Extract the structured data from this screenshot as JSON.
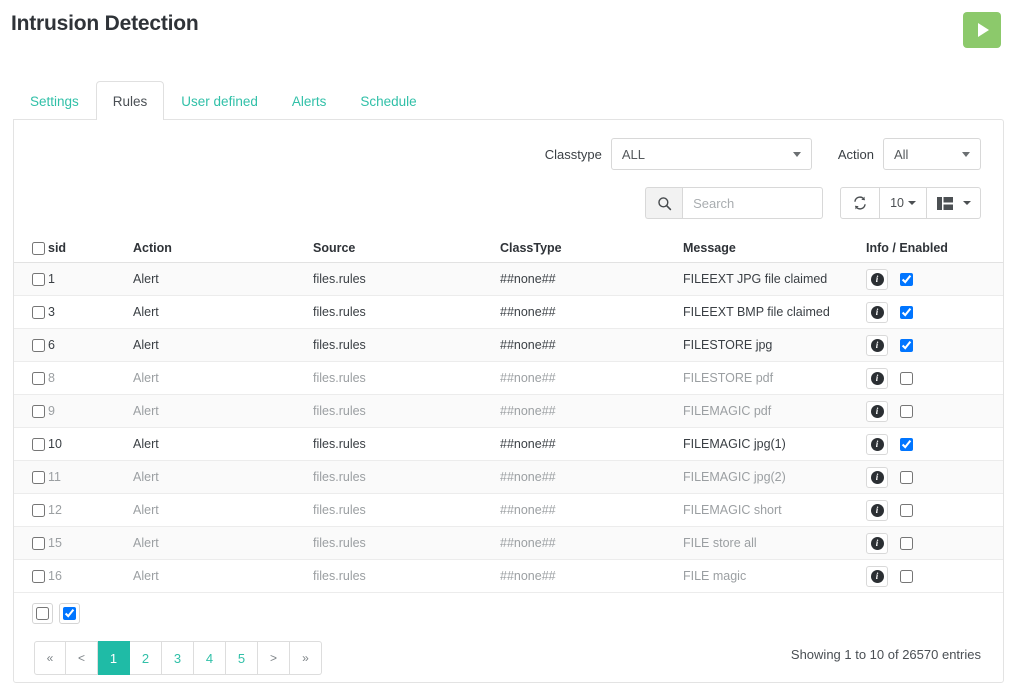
{
  "header": {
    "title": "Intrusion Detection",
    "run_button": {
      "name": "play-button",
      "label": ""
    }
  },
  "tabs": [
    {
      "label": "Settings",
      "active": false
    },
    {
      "label": "Rules",
      "active": true
    },
    {
      "label": "User defined",
      "active": false
    },
    {
      "label": "Alerts",
      "active": false
    },
    {
      "label": "Schedule",
      "active": false
    }
  ],
  "filters": {
    "classtype_label": "Classtype",
    "classtype_value": "ALL",
    "action_label": "Action",
    "action_value": "All"
  },
  "toolbar": {
    "search_placeholder": "Search",
    "search_value": "",
    "search_icon": "search-icon",
    "refresh_icon": "refresh-icon",
    "page_size": "10",
    "columns_icon": "columns-icon"
  },
  "table": {
    "columns": [
      "sid",
      "Action",
      "Source",
      "ClassType",
      "Message",
      "Info / Enabled"
    ],
    "rows": [
      {
        "sid": "1",
        "action": "Alert",
        "source": "files.rules",
        "classtype": "##none##",
        "message": "FILEEXT JPG file claimed",
        "enabled": true
      },
      {
        "sid": "3",
        "action": "Alert",
        "source": "files.rules",
        "classtype": "##none##",
        "message": "FILEEXT BMP file claimed",
        "enabled": true
      },
      {
        "sid": "6",
        "action": "Alert",
        "source": "files.rules",
        "classtype": "##none##",
        "message": "FILESTORE jpg",
        "enabled": true
      },
      {
        "sid": "8",
        "action": "Alert",
        "source": "files.rules",
        "classtype": "##none##",
        "message": "FILESTORE pdf",
        "enabled": false
      },
      {
        "sid": "9",
        "action": "Alert",
        "source": "files.rules",
        "classtype": "##none##",
        "message": "FILEMAGIC pdf",
        "enabled": false
      },
      {
        "sid": "10",
        "action": "Alert",
        "source": "files.rules",
        "classtype": "##none##",
        "message": "FILEMAGIC jpg(1)",
        "enabled": true
      },
      {
        "sid": "11",
        "action": "Alert",
        "source": "files.rules",
        "classtype": "##none##",
        "message": "FILEMAGIC jpg(2)",
        "enabled": false
      },
      {
        "sid": "12",
        "action": "Alert",
        "source": "files.rules",
        "classtype": "##none##",
        "message": "FILEMAGIC short",
        "enabled": false
      },
      {
        "sid": "15",
        "action": "Alert",
        "source": "files.rules",
        "classtype": "##none##",
        "message": "FILE store all",
        "enabled": false
      },
      {
        "sid": "16",
        "action": "Alert",
        "source": "files.rules",
        "classtype": "##none##",
        "message": "FILE magic",
        "enabled": false
      }
    ]
  },
  "pagination": {
    "buttons": [
      {
        "label": "«",
        "active": false,
        "nav": true
      },
      {
        "label": "<",
        "active": false,
        "nav": true
      },
      {
        "label": "1",
        "active": true,
        "nav": false
      },
      {
        "label": "2",
        "active": false,
        "nav": false
      },
      {
        "label": "3",
        "active": false,
        "nav": false
      },
      {
        "label": "4",
        "active": false,
        "nav": false
      },
      {
        "label": "5",
        "active": false,
        "nav": false
      },
      {
        "label": ">",
        "active": false,
        "nav": true
      },
      {
        "label": "»",
        "active": false,
        "nav": true
      }
    ],
    "showing": "Showing 1 to 10 of 26570 entries"
  },
  "colors": {
    "accent_teal": "#1FBBA6",
    "link_teal": "#31c0a8",
    "run_green": "#8CC96B"
  }
}
